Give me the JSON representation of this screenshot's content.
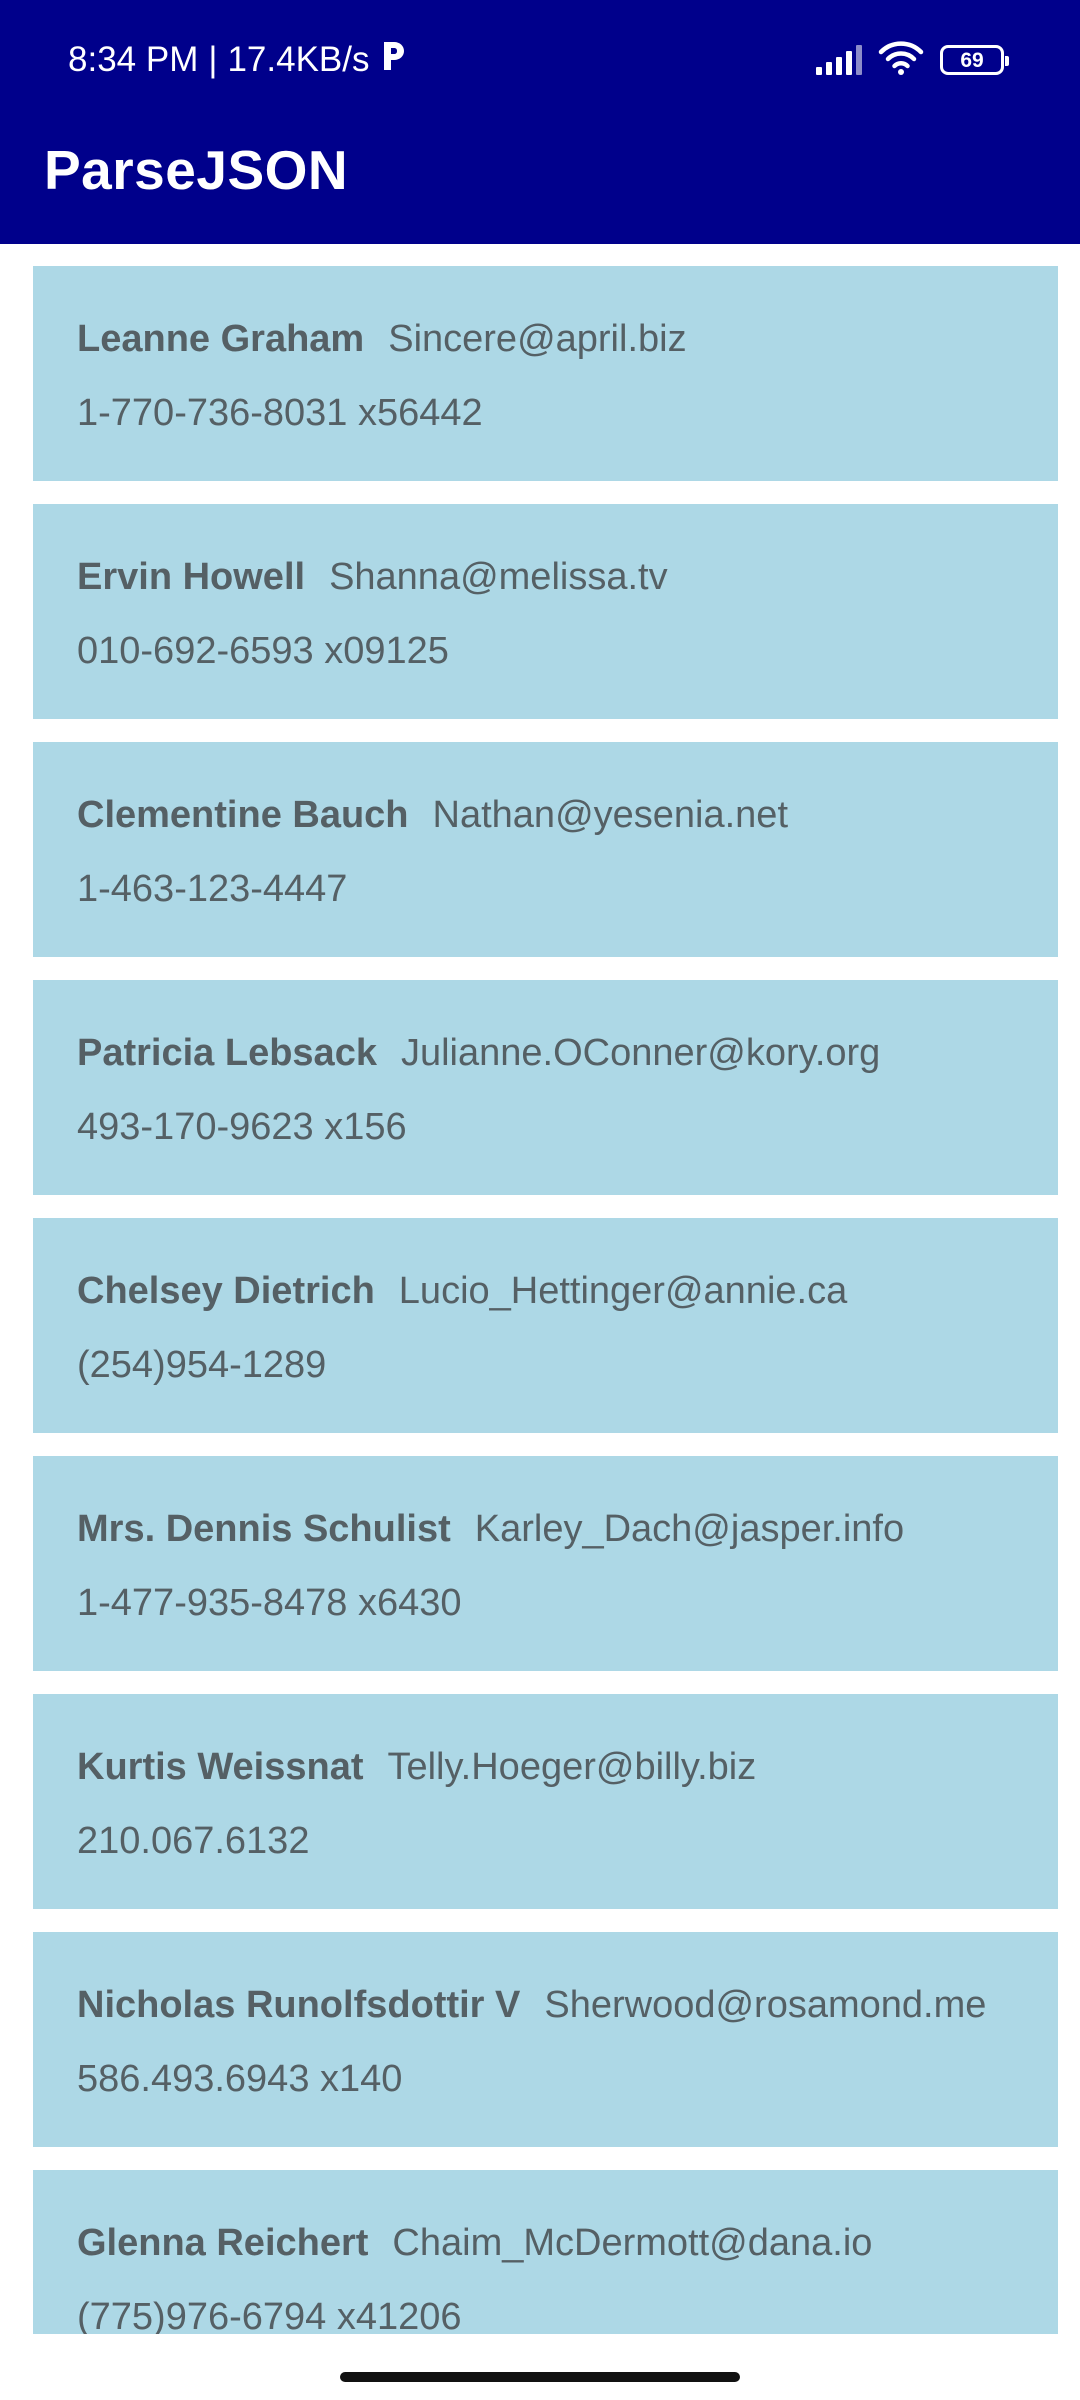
{
  "status_bar": {
    "time": "8:34 PM",
    "separator": "|",
    "net_speed": "17.4KB/s",
    "battery": "69",
    "icons": [
      "app-notification-icon",
      "signal-icon",
      "wifi-icon",
      "battery-icon"
    ]
  },
  "app_bar": {
    "title": "ParseJSON",
    "background": "#00008b"
  },
  "list": {
    "card_background": "#add8e6",
    "items": [
      {
        "name": "Leanne Graham",
        "email": "Sincere@april.biz",
        "phone": "1-770-736-8031 x56442"
      },
      {
        "name": "Ervin Howell",
        "email": "Shanna@melissa.tv",
        "phone": "010-692-6593 x09125"
      },
      {
        "name": "Clementine Bauch",
        "email": "Nathan@yesenia.net",
        "phone": "1-463-123-4447"
      },
      {
        "name": "Patricia Lebsack",
        "email": "Julianne.OConner@kory.org",
        "phone": "493-170-9623 x156"
      },
      {
        "name": "Chelsey Dietrich",
        "email": "Lucio_Hettinger@annie.ca",
        "phone": "(254)954-1289"
      },
      {
        "name": "Mrs. Dennis Schulist",
        "email": "Karley_Dach@jasper.info",
        "phone": "1-477-935-8478 x6430"
      },
      {
        "name": "Kurtis Weissnat",
        "email": "Telly.Hoeger@billy.biz",
        "phone": "210.067.6132"
      },
      {
        "name": "Nicholas Runolfsdottir V",
        "email": "Sherwood@rosamond.me",
        "phone": "586.493.6943 x140"
      },
      {
        "name": "Glenna Reichert",
        "email": "Chaim_McDermott@dana.io",
        "phone": "(775)976-6794 x41206"
      }
    ]
  }
}
